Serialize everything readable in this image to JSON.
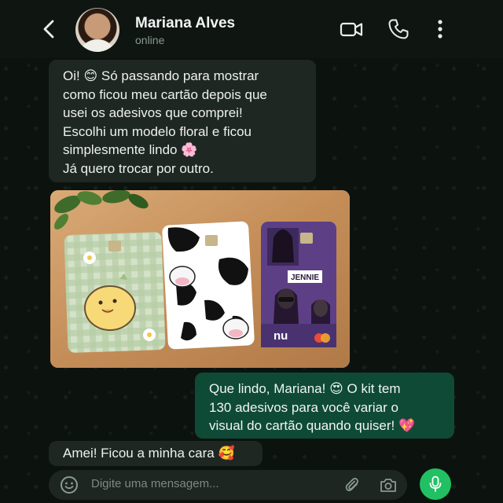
{
  "header": {
    "contact_name": "Mariana Alves",
    "status": "online",
    "icons": [
      "back-arrow-icon",
      "video-call-icon",
      "phone-icon",
      "more-options-icon"
    ]
  },
  "messages": [
    {
      "direction": "incoming",
      "lines": [
        "Oi! 😊 Só passando para mostrar",
        "como ficou meu cartão depois que",
        "usei os adesivos que comprei!",
        "Escolhi um modelo floral e ficou",
        "simplesmente lindo 🌸",
        "Já quero trocar por outro."
      ]
    },
    {
      "direction": "incoming",
      "type": "image",
      "cards": [
        {
          "design": "green gingham with duck",
          "bg": "#c4d6b6"
        },
        {
          "design": "cow print",
          "bg": "#ffffff"
        },
        {
          "design": "purple collage",
          "bg": "#6a4a8e",
          "label": "JENNIE",
          "brand": "nu"
        }
      ]
    },
    {
      "direction": "outgoing",
      "lines": [
        "Que lindo, Mariana! 😍 O kit tem",
        "130 adesivos para você variar o",
        "visual do cartão quando quiser! 💖"
      ]
    },
    {
      "direction": "incoming",
      "lines": [
        "Amei! Ficou a minha cara 🥰"
      ]
    }
  ],
  "composer": {
    "placeholder": "Digite uma mensagem...",
    "icons": [
      "emoji-icon",
      "attach-icon",
      "camera-icon",
      "mic-icon"
    ]
  },
  "colors": {
    "incoming_bubble": "#1f2723",
    "outgoing_bubble": "#0f4a36",
    "mic_button": "#21c063"
  }
}
